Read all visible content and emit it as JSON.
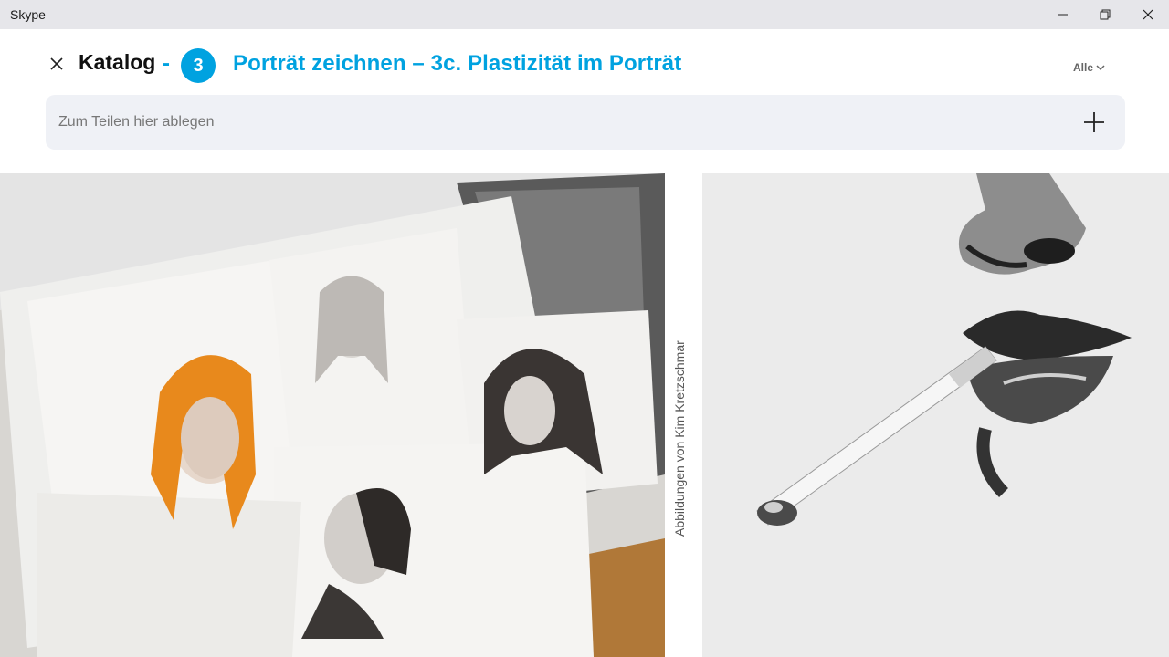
{
  "window": {
    "app_title": "Skype",
    "controls": [
      "minimize-icon",
      "restore-icon",
      "close-icon"
    ]
  },
  "header": {
    "section": "Katalog",
    "separator": "-",
    "step_number": "3",
    "title": "Porträt zeichnen – 3c. Plastizität im Porträt",
    "filter_label": "Alle"
  },
  "dropzone": {
    "placeholder": "Zum Teilen hier ablegen"
  },
  "content": {
    "image_credit": "Abbildungen von Kim Kretzschmar"
  },
  "colors": {
    "accent": "#00a2e0",
    "titlebar_bg": "#e6e6ea",
    "dropzone_bg": "#eff1f6"
  }
}
